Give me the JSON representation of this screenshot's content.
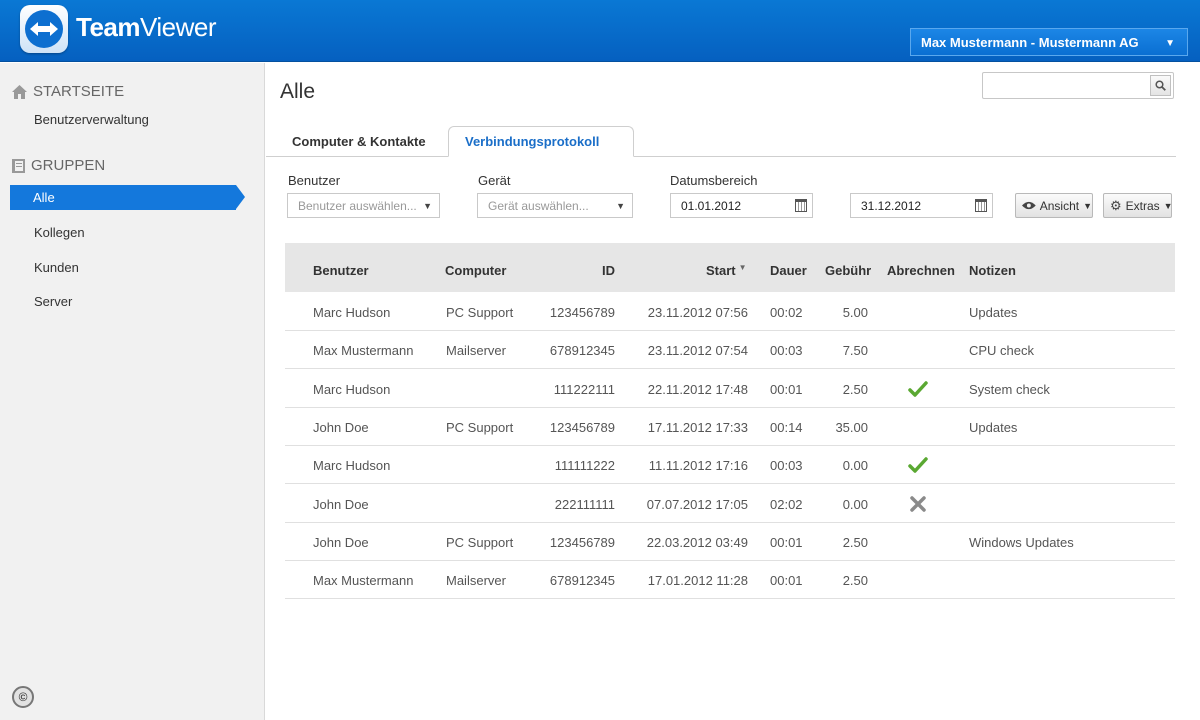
{
  "header": {
    "brand_bold": "Team",
    "brand_regular": "Viewer",
    "user_menu": "Max Mustermann - Mustermann AG"
  },
  "sidebar": {
    "startseite": "STARTSEITE",
    "benutzerverwaltung": "Benutzerverwaltung",
    "gruppen": "GRUPPEN",
    "items": [
      "Alle",
      "Kollegen",
      "Kunden",
      "Server"
    ]
  },
  "main": {
    "title": "Alle",
    "search": {
      "placeholder": ""
    },
    "tabs": [
      "Computer & Kontakte",
      "Verbindungsprotokoll"
    ],
    "filters": {
      "benutzer_label": "Benutzer",
      "benutzer_placeholder": "Benutzer auswählen...",
      "geraet_label": "Gerät",
      "geraet_placeholder": "Gerät auswählen...",
      "datum_label": "Datumsbereich",
      "date_from": "01.01.2012",
      "date_to": "31.12.2012",
      "ansicht": "Ansicht",
      "extras": "Extras"
    }
  },
  "table": {
    "headers": [
      "Benutzer",
      "Computer",
      "ID",
      "Start",
      "Dauer",
      "Gebühr",
      "Abrechnen",
      "Notizen"
    ],
    "rows": [
      {
        "benutzer": "Marc Hudson",
        "computer": "PC Support",
        "id": "123456789",
        "start": "23.11.2012 07:56",
        "dauer": "00:02",
        "gebuehr": "5.00",
        "abrechnen": "",
        "notizen": "Updates"
      },
      {
        "benutzer": "Max Mustermann",
        "computer": "Mailserver",
        "id": "678912345",
        "start": "23.11.2012 07:54",
        "dauer": "00:03",
        "gebuehr": "7.50",
        "abrechnen": "",
        "notizen": "CPU check"
      },
      {
        "benutzer": "Marc Hudson",
        "computer": "",
        "id": "111222111",
        "start": "22.11.2012 17:48",
        "dauer": "00:01",
        "gebuehr": "2.50",
        "abrechnen": "check",
        "notizen": "System check"
      },
      {
        "benutzer": "John Doe",
        "computer": "PC Support",
        "id": "123456789",
        "start": "17.11.2012 17:33",
        "dauer": "00:14",
        "gebuehr": "35.00",
        "abrechnen": "",
        "notizen": "Updates"
      },
      {
        "benutzer": "Marc Hudson",
        "computer": "",
        "id": "111111222",
        "start": "11.11.2012 17:16",
        "dauer": "00:03",
        "gebuehr": "0.00",
        "abrechnen": "check",
        "notizen": ""
      },
      {
        "benutzer": "John Doe",
        "computer": "",
        "id": "222111111",
        "start": "07.07.2012 17:05",
        "dauer": "02:02",
        "gebuehr": "0.00",
        "abrechnen": "cross",
        "notizen": ""
      },
      {
        "benutzer": "John Doe",
        "computer": "PC Support",
        "id": "123456789",
        "start": "22.03.2012 03:49",
        "dauer": "00:01",
        "gebuehr": "2.50",
        "abrechnen": "",
        "notizen": "Windows Updates"
      },
      {
        "benutzer": "Max Mustermann",
        "computer": "Mailserver",
        "id": "678912345",
        "start": "17.01.2012 11:28",
        "dauer": "00:01",
        "gebuehr": "2.50",
        "abrechnen": "",
        "notizen": ""
      }
    ]
  },
  "colors": {
    "accent": "#1478dc",
    "header": "#0a6cd0",
    "check": "#5aa832",
    "cross": "#8a8a8a"
  }
}
